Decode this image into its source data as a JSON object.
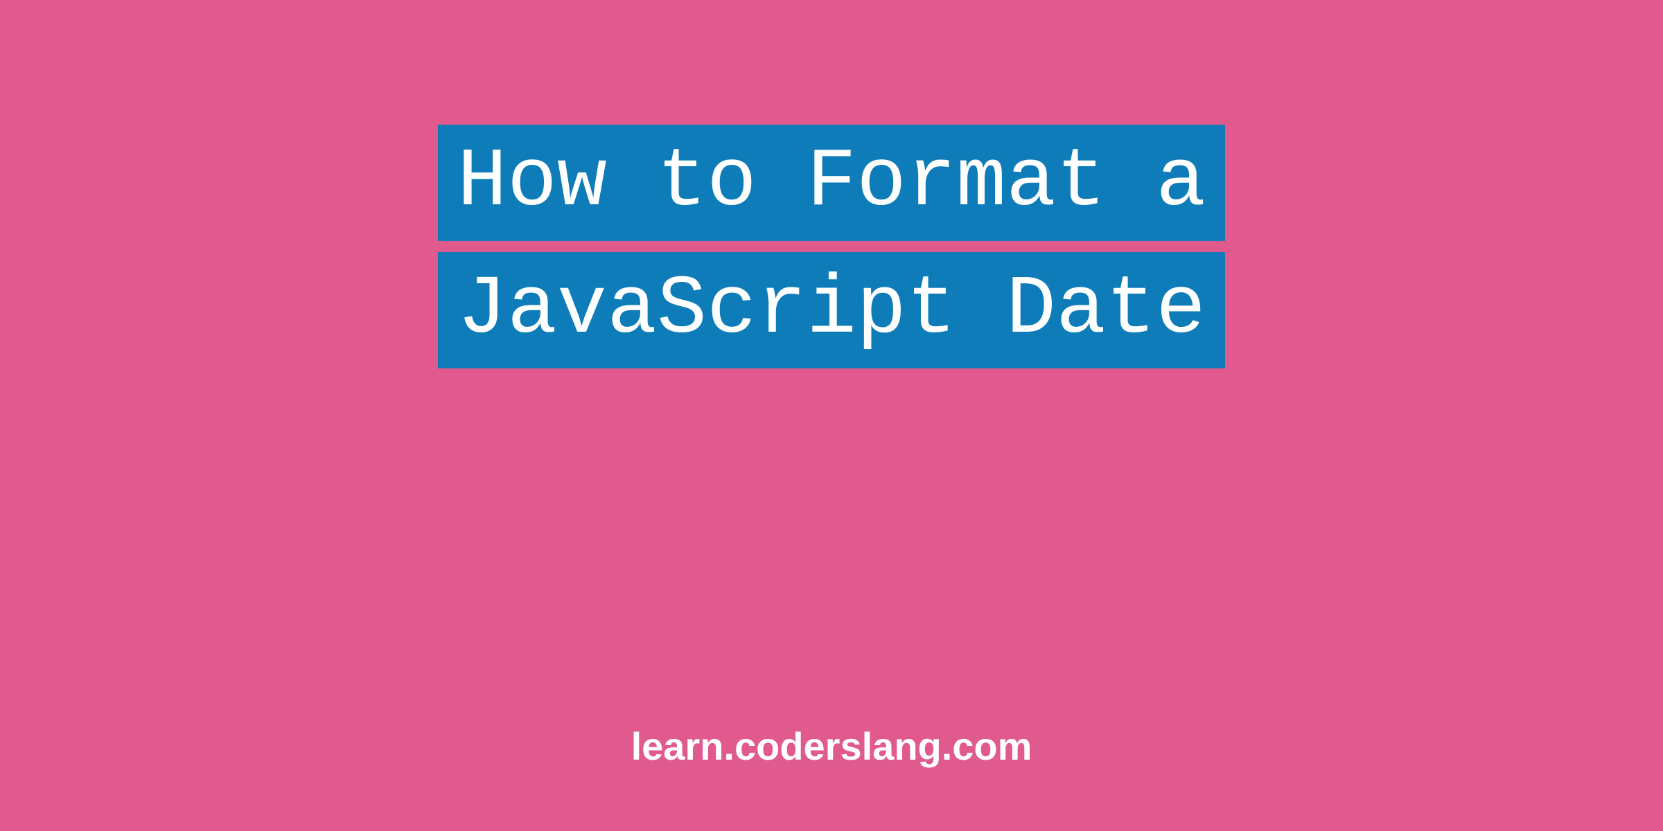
{
  "title": {
    "line1": "How to Format a",
    "line2": "JavaScript Date"
  },
  "footer": {
    "url": "learn.coderslang.com"
  },
  "colors": {
    "background": "#e05a8e",
    "highlight": "#0d7cb8",
    "text": "#ffffff"
  }
}
